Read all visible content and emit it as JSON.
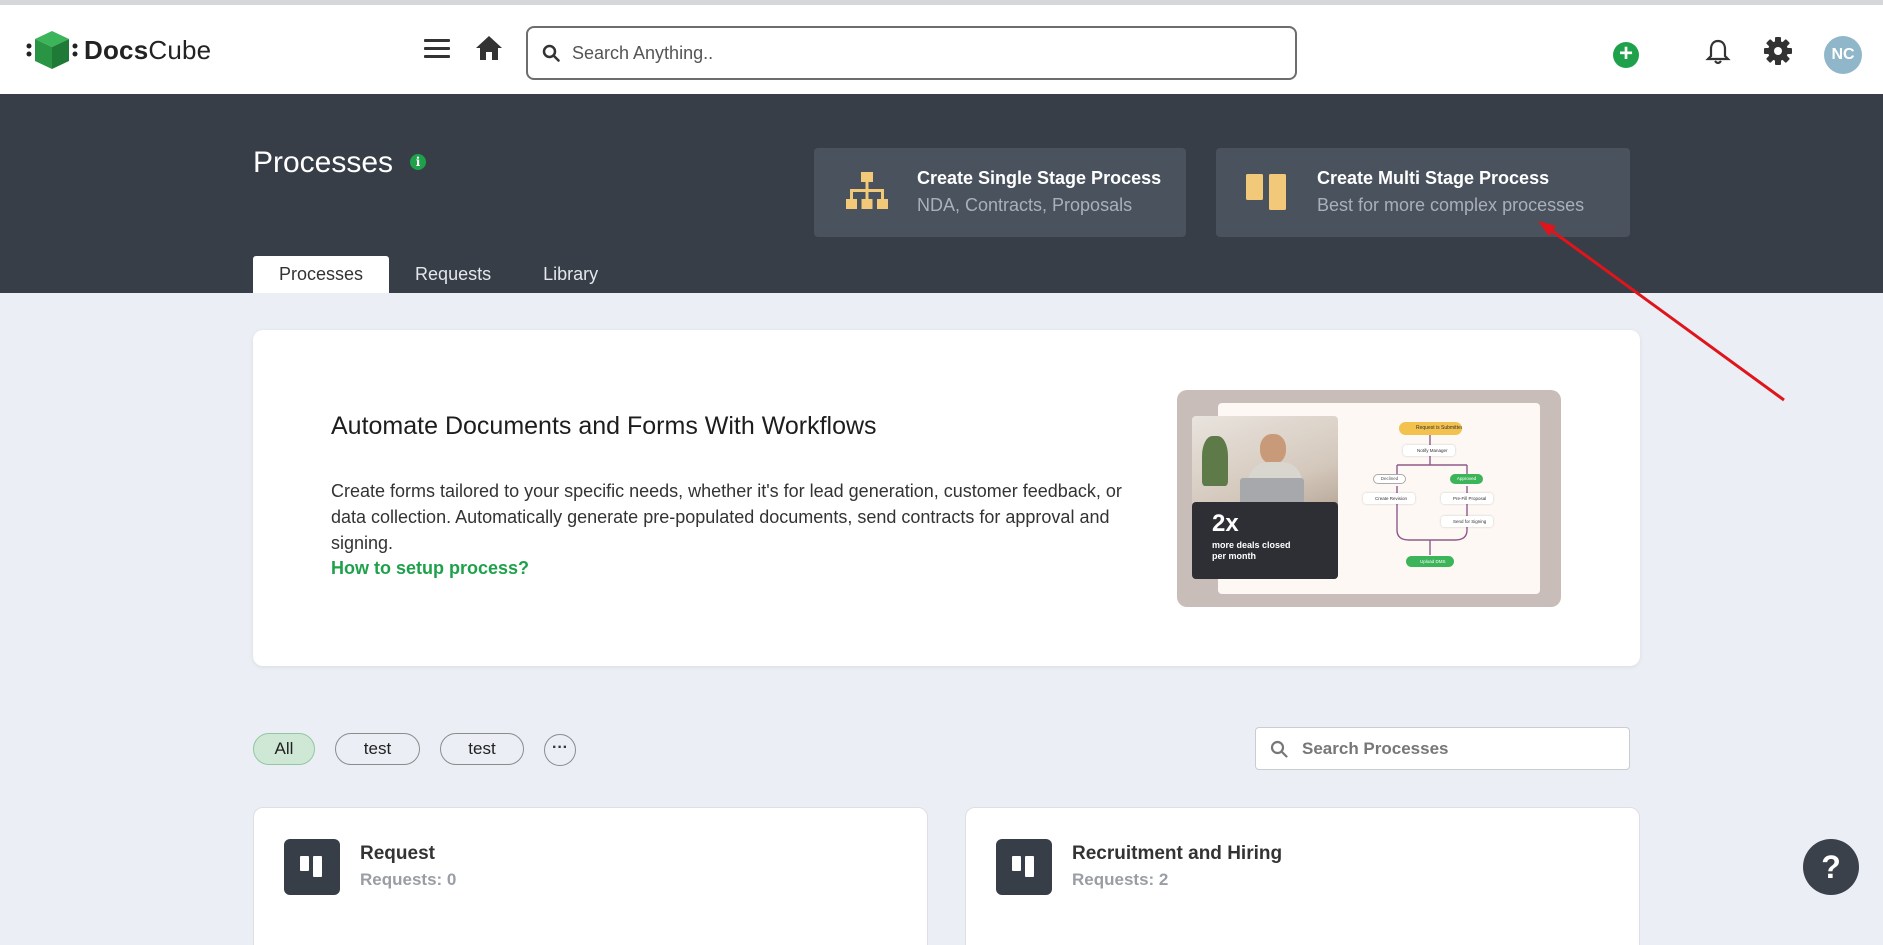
{
  "header": {
    "logo_brand_bold": "Docs",
    "logo_brand_rest": "Cube",
    "search_placeholder": "Search Anything..",
    "avatar_initials": "NC",
    "add_symbol": "+"
  },
  "page": {
    "title": "Processes",
    "info_symbol": "i"
  },
  "create_cards": [
    {
      "title": "Create Single Stage Process",
      "subtitle": "NDA, Contracts, Proposals",
      "icon": "org-chart-icon"
    },
    {
      "title": "Create Multi Stage Process",
      "subtitle": "Best for more complex processes",
      "icon": "columns-icon"
    }
  ],
  "tabs": [
    {
      "label": "Processes",
      "active": true
    },
    {
      "label": "Requests",
      "active": false
    },
    {
      "label": "Library",
      "active": false
    }
  ],
  "promo": {
    "title": "Automate Documents and Forms With Workflows",
    "description": "Create forms tailored to your specific needs, whether it's for lead generation, customer feedback, or data collection. Automatically generate pre-populated documents, send contracts for approval and signing.",
    "link": "How to setup process?",
    "image_stat": "2x",
    "image_stat_caption_1": "more deals closed",
    "image_stat_caption_2": "per month",
    "flow_nodes": {
      "start": "Request is Submitted",
      "notify": "Notify Manager",
      "declined": "Declined",
      "approved": "Approved",
      "revision": "Create Revision",
      "prefill": "Pre-Fill Proposal",
      "signing": "Send for Signing",
      "upload": "Upload DMS"
    }
  },
  "filters": {
    "chips": [
      "All",
      "test",
      "test"
    ],
    "more_symbol": "···",
    "search_placeholder": "Search Processes"
  },
  "processes": [
    {
      "name": "Request",
      "requests": "Requests: 0"
    },
    {
      "name": "Recruitment and Hiring",
      "requests": "Requests: 2"
    }
  ],
  "help_symbol": "?",
  "colors": {
    "accent_green": "#1fa14c",
    "dark_band": "#373e48",
    "annotation_arrow": "#e0141b"
  }
}
